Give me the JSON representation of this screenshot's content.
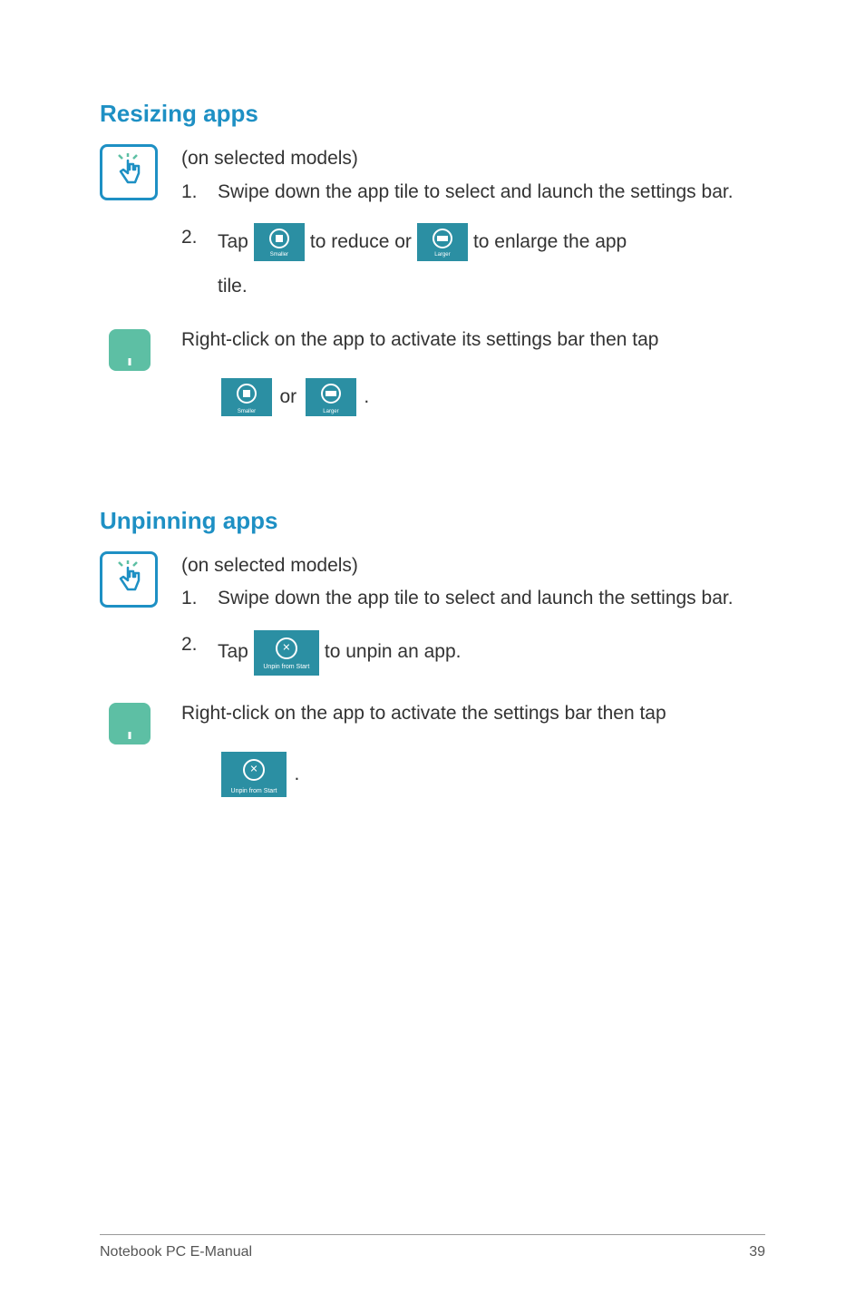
{
  "section1": {
    "heading": "Resizing apps",
    "touch": {
      "subtitle": "(on selected models)",
      "step1_num": "1.",
      "step1_text": "Swipe down the app tile to select and launch the settings bar.",
      "step2_num": "2.",
      "step2_prefix": "Tap ",
      "step2_mid": " to reduce or ",
      "step2_suffix": " to enlarge the app",
      "step2_line2": "tile."
    },
    "touchpad": {
      "text_prefix": "Right-click on the app to activate its settings bar then tap",
      "connector": " or ",
      "period": " ."
    },
    "tile_smaller_label": "Smaller",
    "tile_larger_label": "Larger"
  },
  "section2": {
    "heading": "Unpinning apps",
    "touch": {
      "subtitle": "(on selected models)",
      "step1_num": "1.",
      "step1_text": "Swipe down the app tile to select and launch the settings bar.",
      "step2_num": "2.",
      "step2_prefix": "Tap ",
      "step2_suffix": " to unpin an app."
    },
    "touchpad": {
      "text_prefix": "Right-click on the app to activate the settings bar then tap",
      "period": "."
    },
    "tile_unpin_label": "Unpin from Start"
  },
  "footer": {
    "left": "Notebook PC E-Manual",
    "right": "39"
  }
}
